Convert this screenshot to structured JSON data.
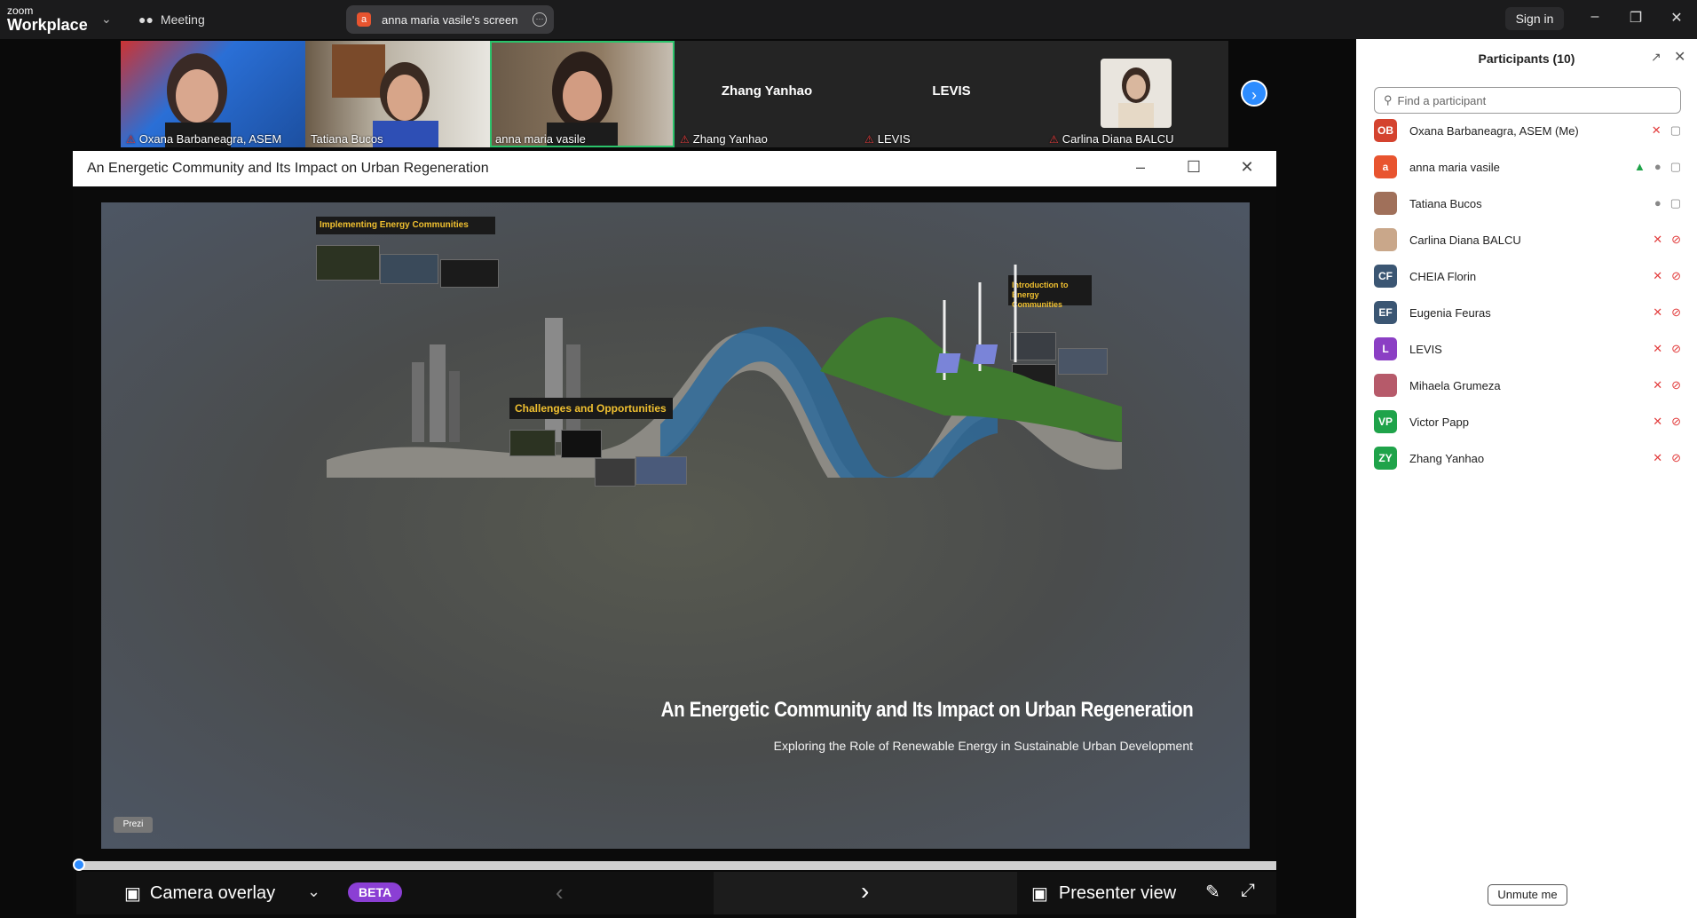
{
  "app": {
    "logo_small": "zoom",
    "logo_big": "Workplace",
    "meeting_label": "Meeting",
    "screen_label": "anna maria vasile's screen",
    "screen_avatar": "a",
    "sign_in": "Sign in"
  },
  "gallery": [
    {
      "name": "Oxana Barbaneagra, ASEM",
      "muted": true
    },
    {
      "name": "Tatiana Bucos",
      "muted": false
    },
    {
      "name": "anna maria vasile",
      "muted": false,
      "active": true
    },
    {
      "name": "Zhang Yanhao",
      "muted": true,
      "big": "Zhang Yanhao"
    },
    {
      "name": "LEVIS",
      "muted": true,
      "big": "LEVIS"
    },
    {
      "name": "Carlina Diana BALCU",
      "muted": true
    }
  ],
  "share_window": {
    "title": "An Energetic Community and Its Impact on Urban Regeneration"
  },
  "slide": {
    "frame_top_left": "Implementing Energy Communities",
    "frame_top_right": "Introduction to Energy Communities",
    "frame_center": "Challenges and Opportunities",
    "title": "An Energetic Community and Its Impact on Urban Regeneration",
    "subtitle": "Exploring the Role of Renewable Energy in Sustainable Urban Development",
    "badge": "Prezi"
  },
  "toolbar": {
    "camera_overlay": "Camera overlay",
    "beta": "BETA",
    "presenter_view": "Presenter view"
  },
  "participants": {
    "title": "Participants (10)",
    "search_placeholder": "Find a participant",
    "unmute": "Unmute me",
    "list": [
      {
        "initials": "OB",
        "name": "Oxana Barbaneagra, ASEM (Me)",
        "color": "#d4432f",
        "mic": "off",
        "video": "on"
      },
      {
        "initials": "a",
        "name": "anna maria vasile",
        "color": "#e8542f",
        "mic": "on",
        "video": "on",
        "sharing": true
      },
      {
        "initials": "",
        "name": "Tatiana Bucos",
        "color": "#a0705a",
        "mic": "on",
        "video": "on"
      },
      {
        "initials": "",
        "name": "Carlina Diana BALCU",
        "color": "#c9a78a",
        "mic": "off",
        "video": "off"
      },
      {
        "initials": "CF",
        "name": "CHEIA Florin",
        "color": "#3b5673",
        "mic": "off",
        "video": "off"
      },
      {
        "initials": "EF",
        "name": "Eugenia Feuras",
        "color": "#3b5673",
        "mic": "off",
        "video": "off"
      },
      {
        "initials": "L",
        "name": "LEVIS",
        "color": "#8b3fc4",
        "mic": "off",
        "video": "off"
      },
      {
        "initials": "",
        "name": "Mihaela Grumeza",
        "color": "#b65a6a",
        "mic": "off",
        "video": "off"
      },
      {
        "initials": "VP",
        "name": "Victor Papp",
        "color": "#1fa34a",
        "mic": "off",
        "video": "off"
      },
      {
        "initials": "ZY",
        "name": "Zhang Yanhao",
        "color": "#1fa34a",
        "mic": "off",
        "video": "off"
      }
    ]
  }
}
